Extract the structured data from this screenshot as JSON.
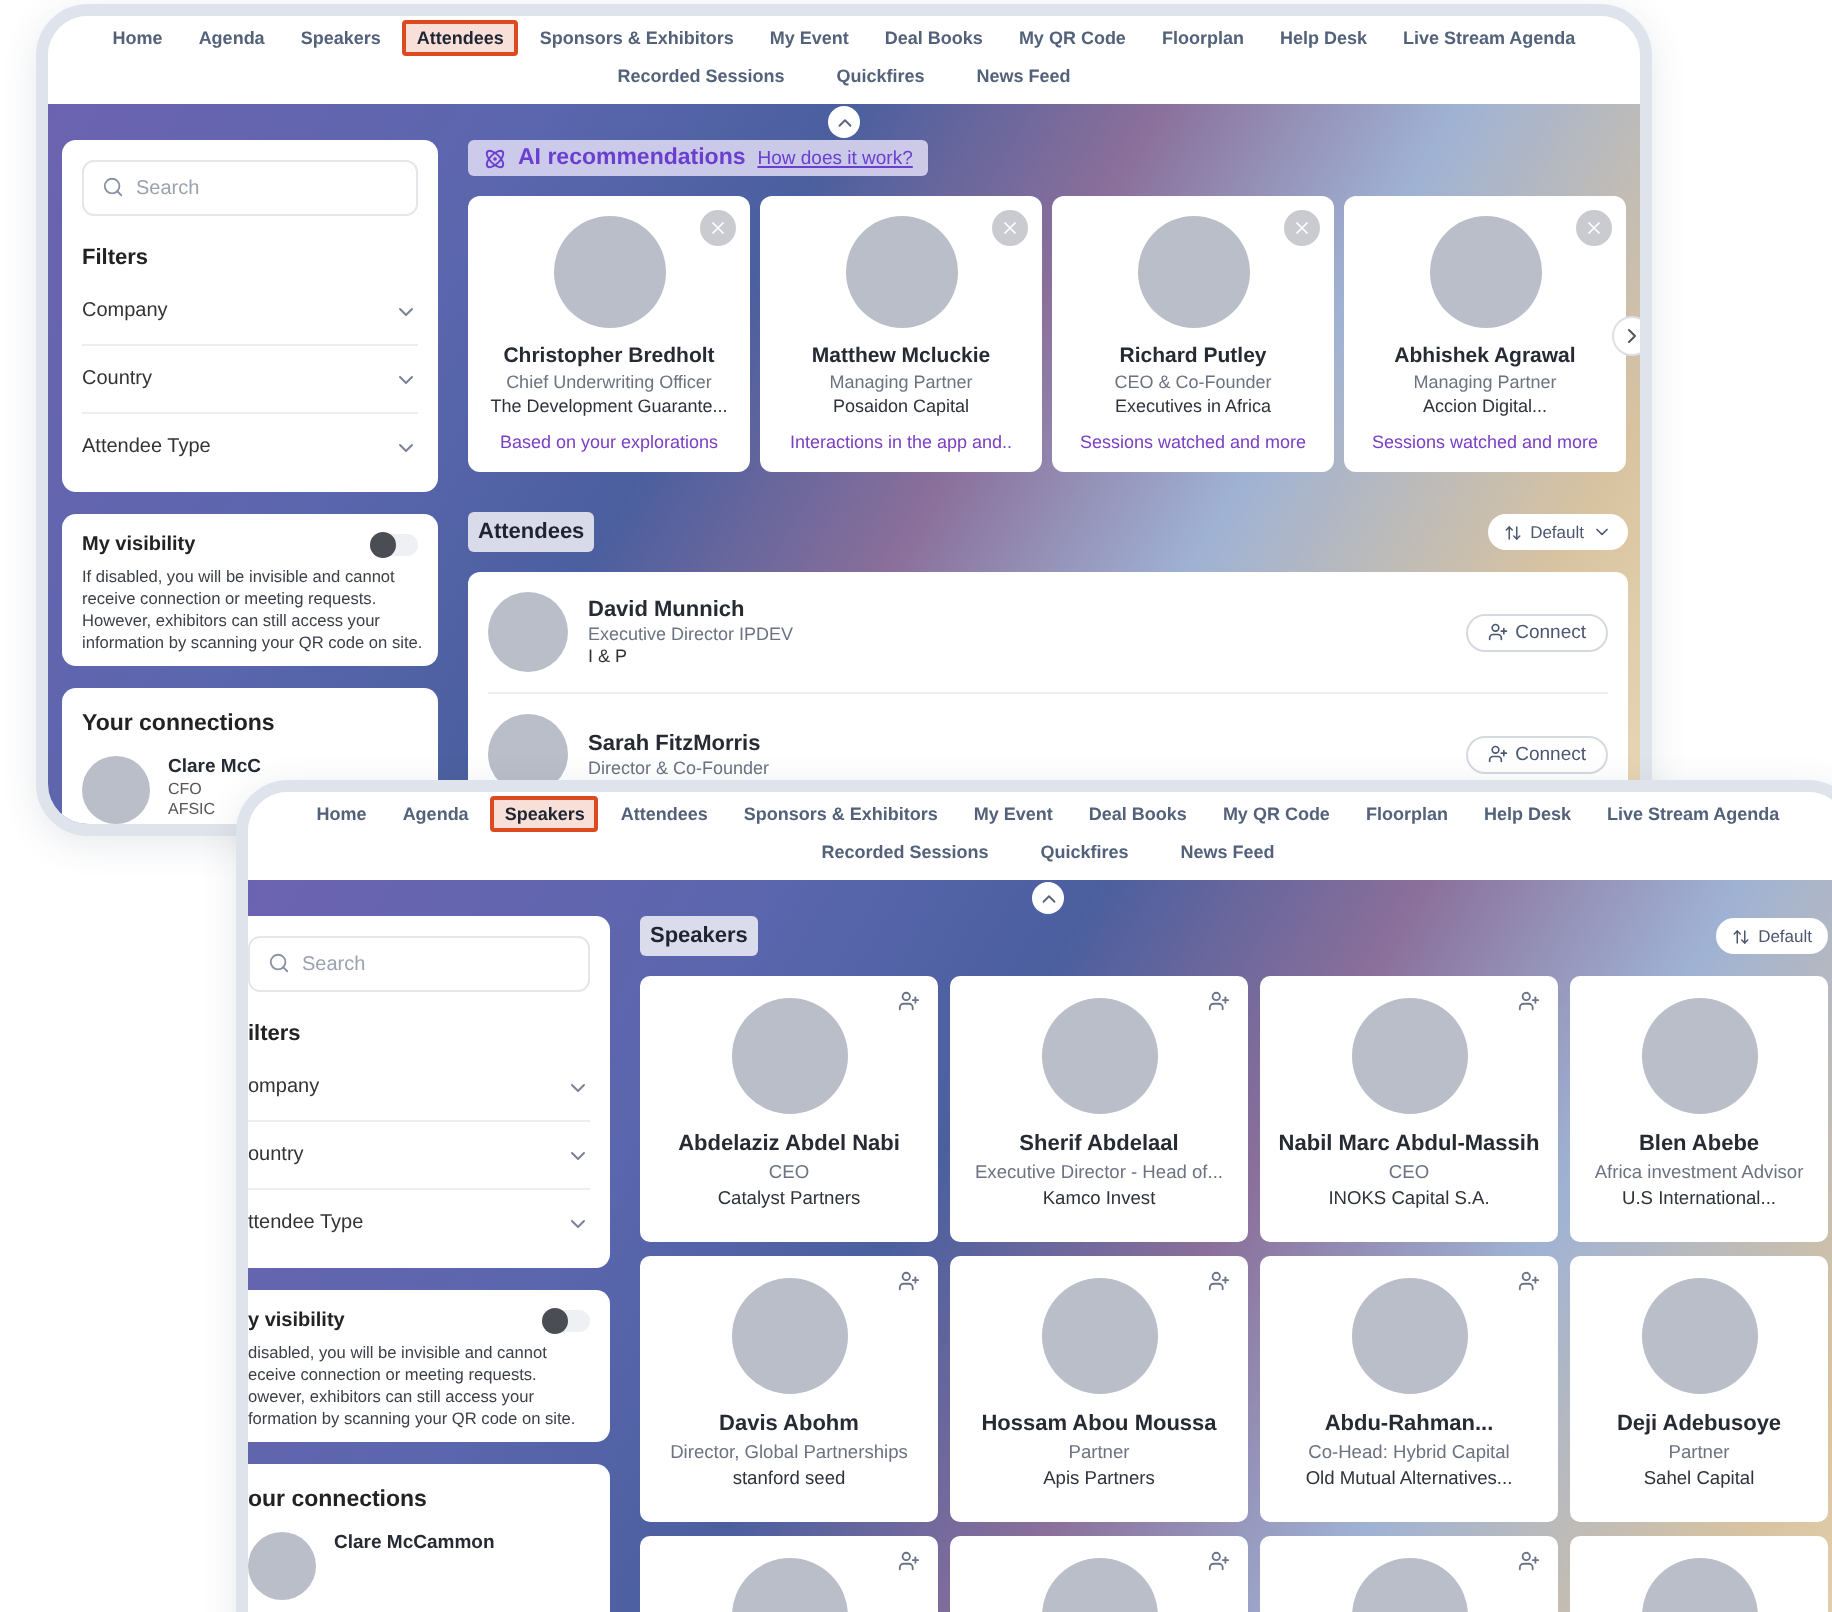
{
  "back_window": {
    "nav": {
      "row_1": [
        {
          "label": "Home",
          "selected": false
        },
        {
          "label": "Agenda",
          "selected": false
        },
        {
          "label": "Speakers",
          "selected": false
        },
        {
          "label": "Attendees",
          "selected": true
        },
        {
          "label": "Sponsors & Exhibitors",
          "selected": false
        },
        {
          "label": "My Event",
          "selected": false
        },
        {
          "label": "Deal Books",
          "selected": false
        },
        {
          "label": "My QR Code",
          "selected": false
        },
        {
          "label": "Floorplan",
          "selected": false
        },
        {
          "label": "Help Desk",
          "selected": false
        },
        {
          "label": "Live Stream Agenda",
          "selected": false
        }
      ],
      "row_2": [
        {
          "label": "Recorded Sessions",
          "selected": false
        },
        {
          "label": "Quickfires",
          "selected": false
        },
        {
          "label": "News Feed",
          "selected": false
        }
      ]
    },
    "sidebar": {
      "search": {
        "placeholder": "Search"
      },
      "filters_title": "Filters",
      "filters": [
        "Company",
        "Country",
        "Attendee Type"
      ],
      "visibility": {
        "title": "My visibility",
        "on": false,
        "lines": [
          "If disabled, you will be invisible and cannot",
          "receive connection or meeting requests.",
          "However, exhibitors can still access your",
          "information by scanning your QR code on site."
        ]
      },
      "connections": {
        "title": "Your connections",
        "items": [
          {
            "name": "Clare McC",
            "role": "CFO",
            "company": "AFSIC"
          }
        ]
      }
    },
    "recommendations": {
      "title": "AI recommendations",
      "link": "How does it work?",
      "cards": [
        {
          "name": "Christopher Bredholt",
          "role": "Chief Underwriting Officer",
          "company": "The Development Guarante...",
          "reason": "Based on your explorations"
        },
        {
          "name": "Matthew Mcluckie",
          "role": "Managing Partner",
          "company": "Posaidon Capital",
          "reason": "Interactions in the app and.."
        },
        {
          "name": "Richard Putley",
          "role": "CEO & Co-Founder",
          "company": "Executives in Africa",
          "reason": "Sessions watched and more"
        },
        {
          "name": "Abhishek Agrawal",
          "role": "Managing Partner",
          "company": "Accion Digital...",
          "reason": "Sessions watched and more"
        }
      ]
    },
    "attendees": {
      "title": "Attendees",
      "sort": "Default",
      "rows": [
        {
          "name": "David Munnich",
          "role": "Executive Director IPDEV",
          "company": "I & P",
          "action": "Connect"
        },
        {
          "name": "Sarah FitzMorris",
          "role": "Director & Co-Founder",
          "action": "Connect"
        }
      ]
    }
  },
  "front_window": {
    "nav": {
      "row_1": [
        {
          "label": "Home",
          "selected": false
        },
        {
          "label": "Agenda",
          "selected": false
        },
        {
          "label": "Speakers",
          "selected": true
        },
        {
          "label": "Attendees",
          "selected": false
        },
        {
          "label": "Sponsors & Exhibitors",
          "selected": false
        },
        {
          "label": "My Event",
          "selected": false
        },
        {
          "label": "Deal Books",
          "selected": false
        },
        {
          "label": "My QR Code",
          "selected": false
        },
        {
          "label": "Floorplan",
          "selected": false
        },
        {
          "label": "Help Desk",
          "selected": false
        },
        {
          "label": "Live Stream Agenda",
          "selected": false
        }
      ],
      "row_2": [
        {
          "label": "Recorded Sessions",
          "selected": false
        },
        {
          "label": "Quickfires",
          "selected": false
        },
        {
          "label": "News Feed",
          "selected": false
        }
      ]
    },
    "sidebar": {
      "search": {
        "placeholder": "Search"
      },
      "filters_title": "ilters",
      "filters": [
        "ompany",
        "ountry",
        "ttendee Type"
      ],
      "visibility": {
        "title": "y visibility",
        "on": false,
        "lines": [
          "disabled, you will be invisible and cannot",
          "eceive connection or meeting requests.",
          "owever, exhibitors can still access your",
          "formation by scanning your QR code on site."
        ]
      },
      "connections": {
        "title": "our connections",
        "items": [
          {
            "name": "Clare McCammon"
          }
        ]
      }
    },
    "speakers": {
      "title": "Speakers",
      "sort": "Default",
      "cards": [
        {
          "kind": "full",
          "name": "Abdelaziz Abdel Nabi",
          "role": "CEO",
          "company": "Catalyst Partners"
        },
        {
          "kind": "full",
          "name": "Sherif Abdelaal",
          "role": "Executive Director - Head of...",
          "company": "Kamco Invest"
        },
        {
          "kind": "full",
          "name": "Nabil Marc Abdul-Massih",
          "role": "CEO",
          "company": "INOKS Capital S.A."
        },
        {
          "kind": "full",
          "name": "Blen Abebe",
          "role": "Africa investment Advisor",
          "company": "U.S International..."
        },
        {
          "kind": "full",
          "name": "Davis Abohm",
          "role": "Director, Global Partnerships",
          "company": "stanford seed"
        },
        {
          "kind": "full",
          "name": "Hossam Abou Moussa",
          "role": "Partner",
          "company": "Apis Partners"
        },
        {
          "kind": "full",
          "name": "Abdu-Rahman...",
          "role": "Co-Head: Hybrid Capital",
          "company": "Old Mutual Alternatives..."
        },
        {
          "kind": "full",
          "name": "Deji Adebusoye",
          "role": "Partner",
          "company": "Sahel Capital"
        },
        {
          "kind": "partial"
        },
        {
          "kind": "partial"
        },
        {
          "kind": "partial"
        },
        {
          "kind": "partial"
        }
      ]
    }
  }
}
